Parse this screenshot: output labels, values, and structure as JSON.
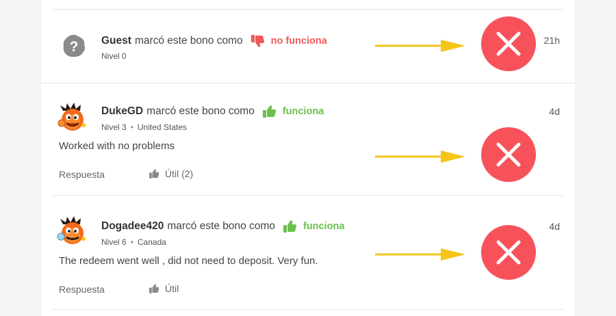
{
  "reviews": [
    {
      "user": "Guest",
      "verb": "marcó este bono como",
      "verdict": "no funciona",
      "verdict_type": "negative",
      "level": "Nivel 0",
      "country": "",
      "time": "21h",
      "comment": "",
      "reply_label": "",
      "useful_label": ""
    },
    {
      "user": "DukeGD",
      "verb": "marcó este bono como",
      "verdict": "funciona",
      "verdict_type": "positive",
      "level": "Nivel 3",
      "country": "United States",
      "time": "4d",
      "comment": "Worked with no problems",
      "reply_label": "Respuesta",
      "useful_label": "Útil (2)"
    },
    {
      "user": "Dogadee420",
      "verb": "marcó este bono como",
      "verdict": "funciona",
      "verdict_type": "positive",
      "level": "Nivel 6",
      "country": "Canada",
      "time": "4d",
      "comment": "The redeem went well , did not need to deposit. Very fun.",
      "reply_label": "Respuesta",
      "useful_label": "Útil"
    }
  ],
  "separator": "•",
  "colors": {
    "negative": "#f15a5a",
    "positive": "#6cc04a",
    "annotation_arrow": "#f5c518",
    "annotation_x": "#f7525a"
  },
  "icons": {
    "guest_avatar": "question-mark-blob-icon",
    "user_avatar": "cartoon-mascot-avatar",
    "negative": "thumbs-down-icon",
    "positive": "thumbs-up-icon",
    "useful": "thumbs-up-icon",
    "annotation": "red-x-circle-icon"
  }
}
